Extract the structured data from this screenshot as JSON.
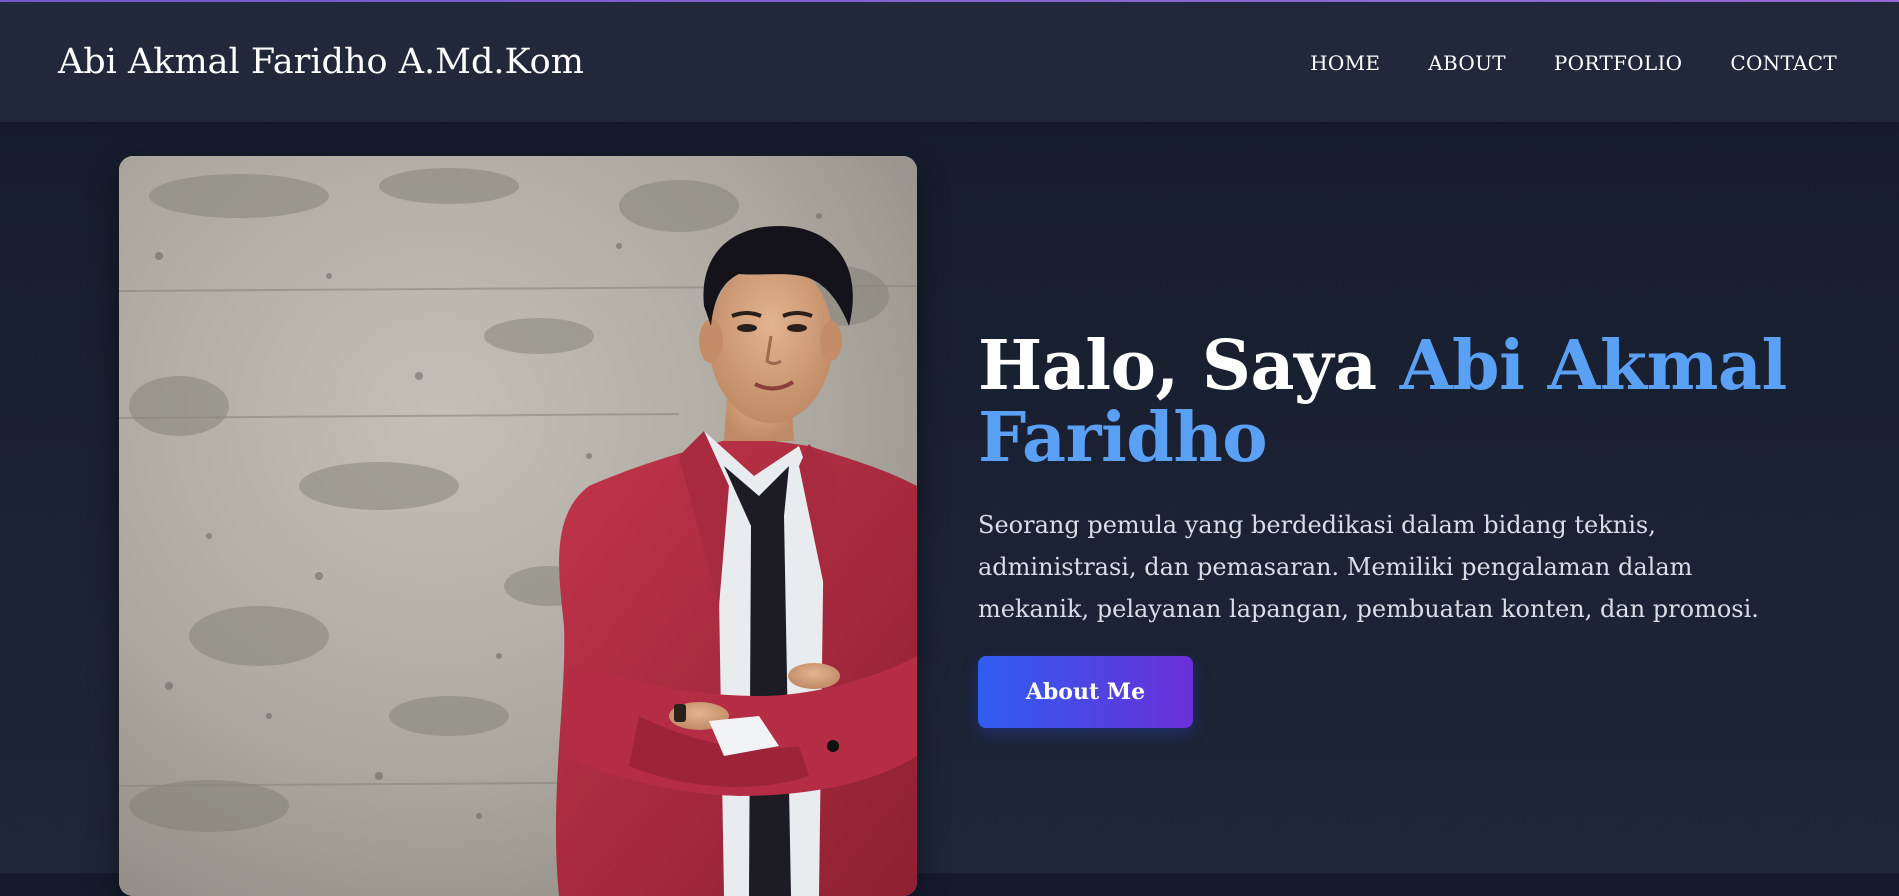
{
  "header": {
    "brand": "Abi Akmal Faridho A.Md.Kom",
    "nav": [
      "HOME",
      "ABOUT",
      "PORTFOLIO",
      "CONTACT"
    ]
  },
  "hero": {
    "title_prefix": "Halo, Saya ",
    "title_name": "Abi Akmal Faridho",
    "description": "Seorang pemula yang berdedikasi dalam bidang teknis, administrasi, dan pemasaran. Memiliki pengalaman dalam mekanik, pelayanan lapangan, pembuatan konten, dan promosi.",
    "button_label": "About Me"
  },
  "colors": {
    "accent_name": "#5aa0f5",
    "button_gradient_start": "#2f5df0",
    "button_gradient_end": "#6a2fd8",
    "navbar_bg": "#202839",
    "page_bg": "#151b2b"
  },
  "icons": []
}
